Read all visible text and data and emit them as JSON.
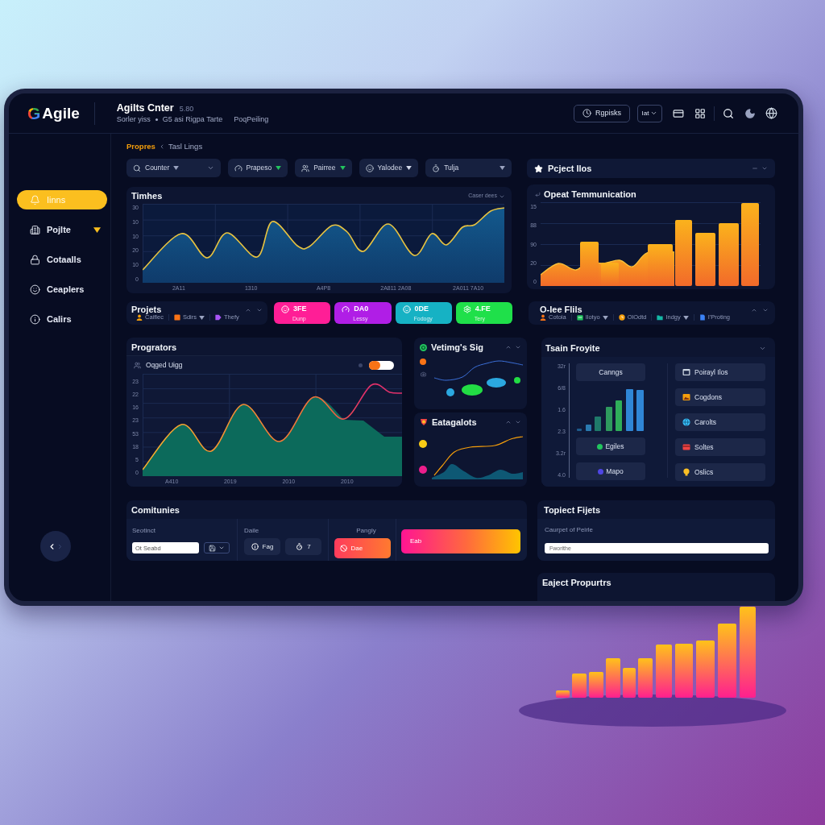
{
  "header": {
    "logo": {
      "mark": "G",
      "name": "Agile"
    },
    "title": "Agilts Cnter",
    "version": "5.80",
    "subtitle": [
      "Sorler yiss",
      "G5 asi Rigpa Tarte",
      "PoqPeiling"
    ],
    "action_button": "Rgpisks",
    "select": "Iat"
  },
  "sidebar": {
    "items": [
      {
        "label": "Iinns",
        "selected": true,
        "expandable": false
      },
      {
        "label": "Pojlte",
        "selected": false,
        "expandable": true
      },
      {
        "label": "Cotaalls",
        "selected": false,
        "expandable": false
      },
      {
        "label": "Ceaplers",
        "selected": false,
        "expandable": false
      },
      {
        "label": "Calirs",
        "selected": false,
        "expandable": false
      }
    ]
  },
  "breadcrumb": [
    {
      "label": "Propres",
      "selected": true
    },
    {
      "label": "Tasl Lings",
      "selected": false
    }
  ],
  "filters": [
    {
      "label": "Counter",
      "kind": "search",
      "color": "#9aa3c0"
    },
    {
      "label": "Prapeso",
      "kind": "chip",
      "color": "#22c55e"
    },
    {
      "label": "Pairree",
      "kind": "chip",
      "color": "#22c55e"
    },
    {
      "label": "Yalodee",
      "kind": "chip",
      "color": "#d5dbeb"
    },
    {
      "label": "Tulja",
      "kind": "wide",
      "color": "#9aa3c0"
    }
  ],
  "timeline": {
    "title": "Timhes",
    "menu": "Caser dees",
    "y_labels": [
      "30",
      "10",
      "10",
      "20",
      "10",
      "0"
    ],
    "x_labels": [
      "2A11",
      "1310",
      "A4P8",
      "2A811 2A08",
      "2A011 7A10"
    ]
  },
  "project_files": {
    "title": "Pcject Ilos"
  },
  "communication": {
    "title": "Opeat Temmunication",
    "y_labels": [
      "15",
      "88",
      "90",
      "20",
      "0"
    ]
  },
  "projects": {
    "title": "Projets",
    "items": [
      {
        "label": "Caiflec",
        "color": "#f59e0b",
        "dropdown": false
      },
      {
        "label": "Sdirs",
        "color": "#f97316",
        "dropdown": true
      },
      {
        "label": "Thefy",
        "color": "#a855f7",
        "dropdown": false
      }
    ]
  },
  "stats": [
    {
      "value": "3FE",
      "label": "Dunp",
      "color": "#ff1e96"
    },
    {
      "value": "DA0",
      "label": "Lessy",
      "color": "#b01ee6"
    },
    {
      "value": "0DE",
      "label": "Fodogy",
      "color": "#16b2c4"
    },
    {
      "value": "4.FE",
      "label": "Tery",
      "color": "#1fe04a"
    }
  ],
  "office_files": {
    "title": "O-Iee Flils",
    "items": [
      {
        "label": "Cotoia",
        "color": "#f97316",
        "dropdown": false
      },
      {
        "label": "Ilotyo",
        "color": "#22c55e",
        "dropdown": true
      },
      {
        "label": "OlOdtd",
        "color": "#f59e0b",
        "dropdown": false
      },
      {
        "label": "Indgy",
        "color": "#14b8a6",
        "dropdown": true
      },
      {
        "label": "I'Proting",
        "color": "#3b82f6",
        "dropdown": false
      }
    ]
  },
  "progress": {
    "title": "Progrators",
    "subtitle": "Oqged Uigg",
    "toggle": {
      "on": true
    },
    "y_labels": [
      "23",
      "22",
      "16",
      "23",
      "53",
      "18",
      "5",
      "0"
    ],
    "x_labels": [
      "A410",
      "2019",
      "2010",
      "2010"
    ]
  },
  "voting": {
    "title": "Vetimg's Sig"
  },
  "categories": {
    "title": "Eatagalots"
  },
  "team": {
    "title": "Tsain Froyite",
    "y_labels": [
      "32r",
      "6/8",
      "1.6",
      "2.3",
      "3.2r",
      "4.0"
    ],
    "buttons": [
      {
        "label": "Canngs"
      },
      {
        "label": "Egiles",
        "color": "#22c55e"
      },
      {
        "label": "Mapo",
        "color": "#4f46e5"
      }
    ],
    "list": [
      {
        "label": "Poirayl Ilos",
        "color": "#cbd5e1"
      },
      {
        "label": "Cogdons",
        "color": "#f59e0b"
      },
      {
        "label": "Carolts",
        "color": "#38bdf8"
      },
      {
        "label": "Soltes",
        "color": "#ef4444"
      },
      {
        "label": "Oslics",
        "color": "#fbbf24"
      }
    ]
  },
  "communities": {
    "title": "Comitunies",
    "columns": [
      {
        "kind": "input",
        "label": "Seotinct",
        "placeholder": "Ot Seabd"
      },
      {
        "kind": "buttons",
        "label": "Daile",
        "buttons": [
          "Fag",
          "7"
        ]
      },
      {
        "kind": "action",
        "label": "Pangly",
        "button": "Dae"
      },
      {
        "kind": "banner",
        "button": "Eab"
      }
    ]
  },
  "topics": {
    "title": "Topiect Fijets",
    "label": "Caurpet of Peirle",
    "input": {
      "placeholder": "Fworithe"
    }
  },
  "extra": {
    "title": "Eaject Propurtrs"
  }
}
